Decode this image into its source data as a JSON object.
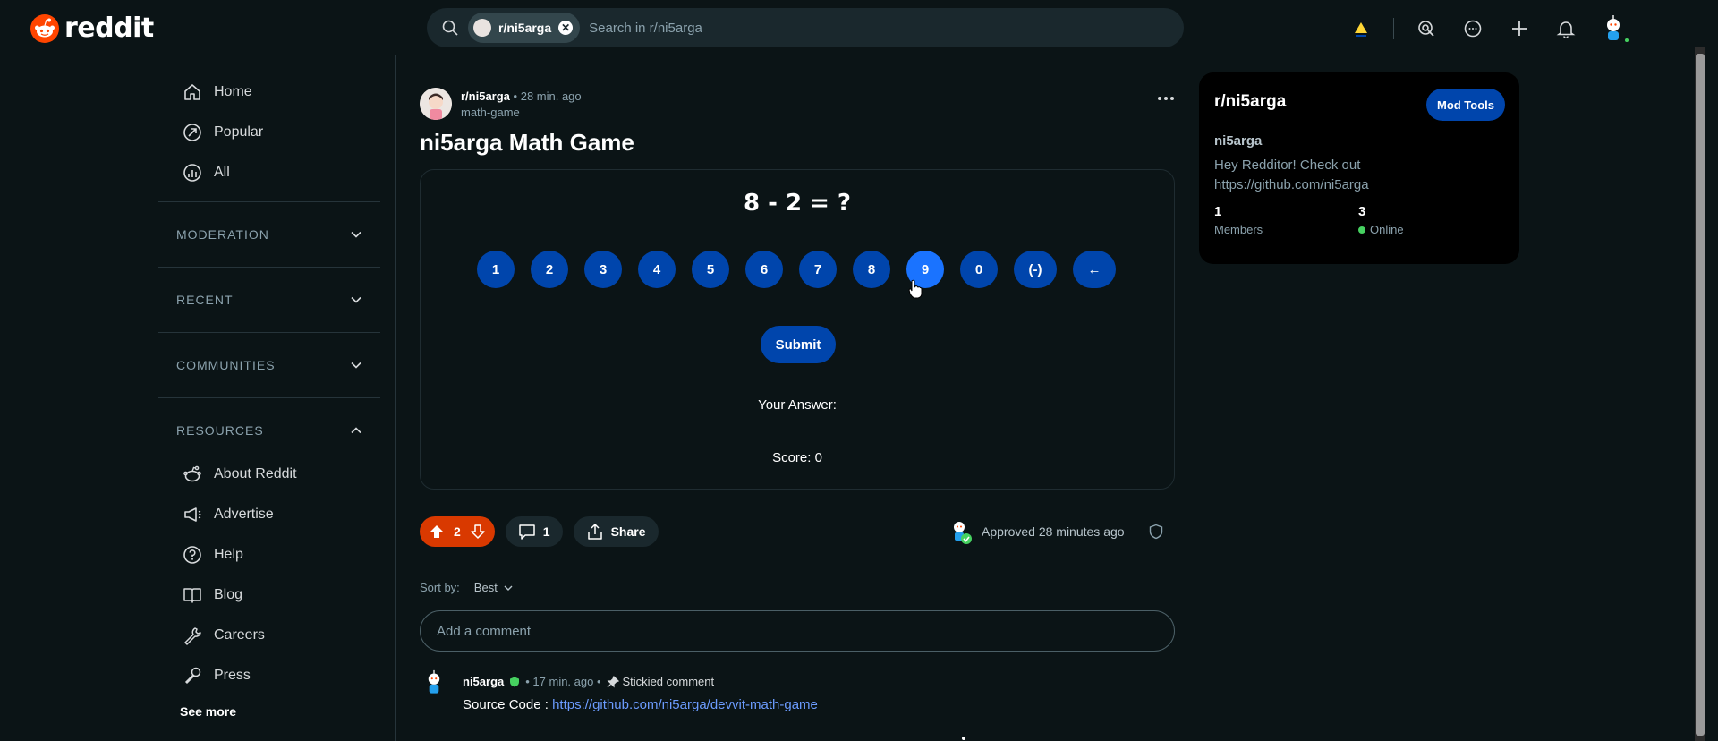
{
  "app": {
    "logo_text": "reddit",
    "brand_color": "#ff4500",
    "accent_color": "#0045ac"
  },
  "search": {
    "chip_label": "r/ni5arga",
    "placeholder": "Search in r/ni5arga"
  },
  "topbar": {
    "icons": [
      "advertise-icon",
      "mod-icon",
      "chat-icon",
      "create-icon",
      "notifications-icon",
      "user-avatar"
    ]
  },
  "sidebar": {
    "items": [
      {
        "label": "Home",
        "icon": "home-icon"
      },
      {
        "label": "Popular",
        "icon": "popular-icon"
      },
      {
        "label": "All",
        "icon": "all-icon"
      }
    ],
    "sections": [
      {
        "label": "MODERATION",
        "expanded": false
      },
      {
        "label": "RECENT",
        "expanded": false
      },
      {
        "label": "COMMUNITIES",
        "expanded": false
      },
      {
        "label": "RESOURCES",
        "expanded": true
      }
    ],
    "resources": [
      {
        "label": "About Reddit",
        "icon": "reddit-alien-icon"
      },
      {
        "label": "Advertise",
        "icon": "megaphone-icon"
      },
      {
        "label": "Help",
        "icon": "help-icon"
      },
      {
        "label": "Blog",
        "icon": "book-icon"
      },
      {
        "label": "Careers",
        "icon": "wrench-icon"
      },
      {
        "label": "Press",
        "icon": "microphone-icon"
      }
    ],
    "see_more": "See more"
  },
  "post": {
    "subreddit": "r/ni5arga",
    "time": "• 28 min. ago",
    "flair": "math-game",
    "title": "ni5arga Math Game",
    "game": {
      "equation": "8 - 2 = ?",
      "keys": [
        "1",
        "2",
        "3",
        "4",
        "5",
        "6",
        "7",
        "8",
        "9",
        "0",
        "(-)",
        "←"
      ],
      "active_key": "9",
      "submit_label": "Submit",
      "answer_label": "Your Answer:",
      "score_label": "Score: 0"
    },
    "votes": "2",
    "comments": "1",
    "share_label": "Share",
    "approved_text": "Approved 28 minutes ago"
  },
  "comments_section": {
    "sort_label": "Sort by:",
    "sort_value": "Best",
    "add_placeholder": "Add a comment",
    "items": [
      {
        "author": "ni5arga",
        "time": "• 17 min. ago •",
        "stickied": "Stickied comment",
        "body_prefix": "Source Code : ",
        "link": "https://github.com/ni5arga/devvit-math-game"
      }
    ]
  },
  "community_card": {
    "title": "r/ni5arga",
    "mod_tools_label": "Mod Tools",
    "name": "ni5arga",
    "description": "Hey Redditor! Check out https://github.com/ni5arga",
    "members_count": "1",
    "members_label": "Members",
    "online_count": "3",
    "online_label": "Online"
  }
}
